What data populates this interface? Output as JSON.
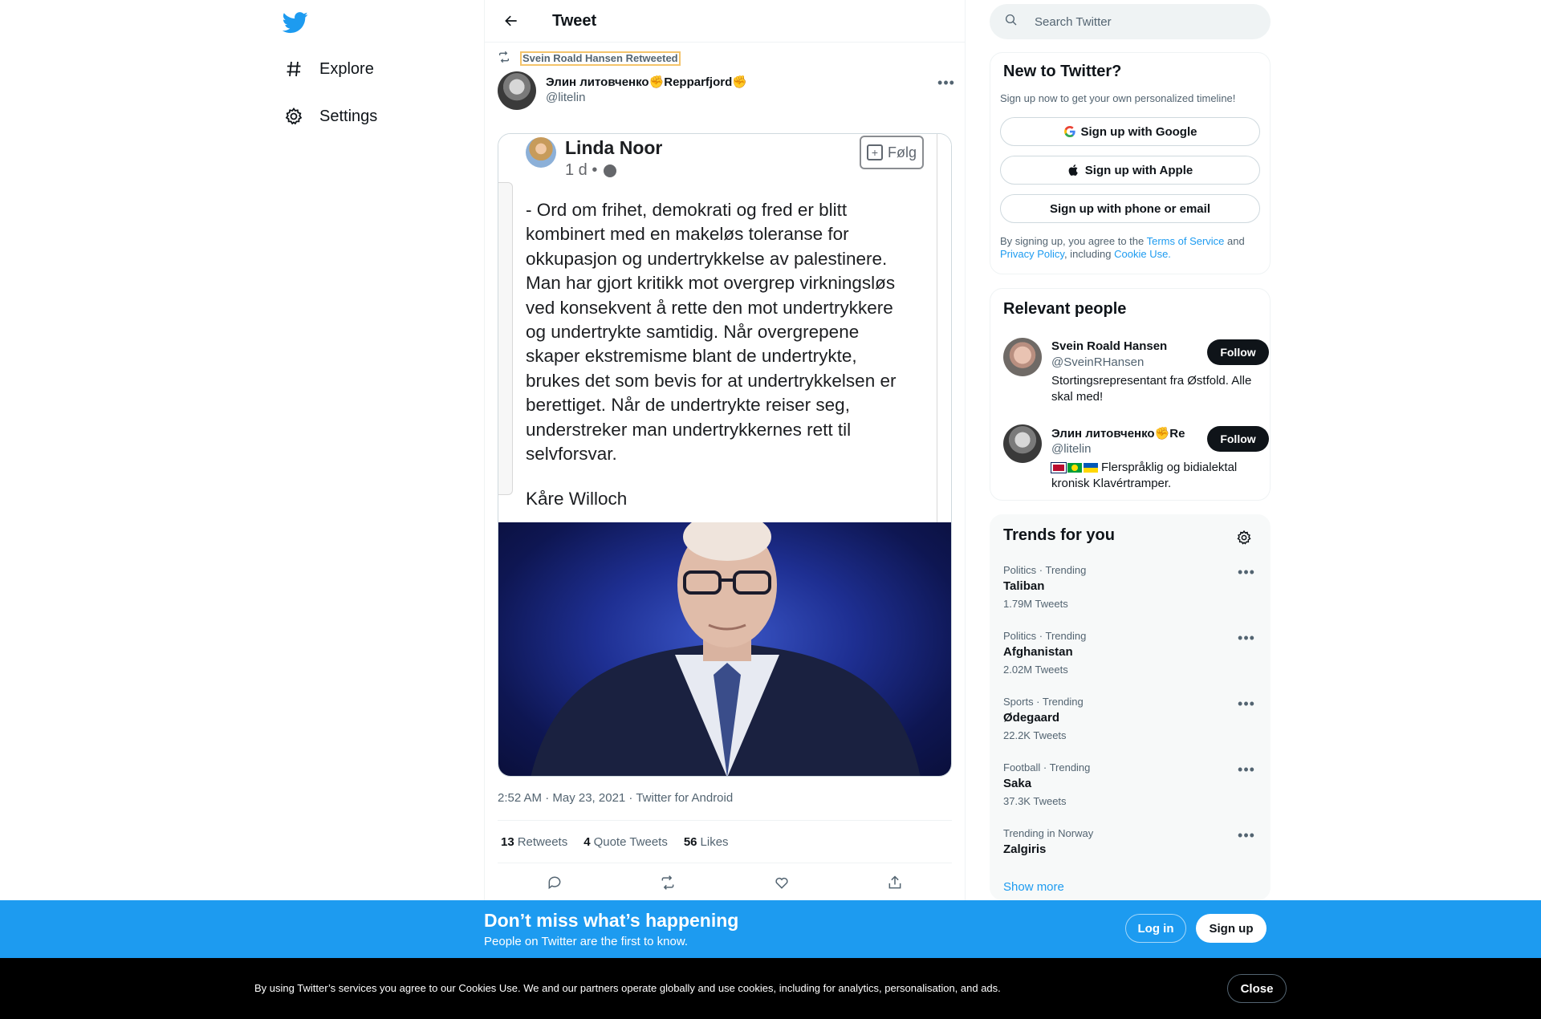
{
  "nav": {
    "explore_label": "Explore",
    "settings_label": "Settings"
  },
  "header": {
    "title": "Tweet"
  },
  "tweet": {
    "retweeted_by": "Svein Roald Hansen Retweeted",
    "author_name": "Элин литовченко✊Repparfjord✊",
    "author_handle": "@litelin",
    "timestamp": "2:52 AM · May 23, 2021 · Twitter for Android",
    "stats": {
      "retweets_count": "13",
      "retweets_label": "Retweets",
      "quotes_count": "4",
      "quotes_label": "Quote Tweets",
      "likes_count": "56",
      "likes_label": "Likes"
    },
    "media": {
      "fb_name": "Linda Noor",
      "fb_meta": "1 d •",
      "fb_follow": "Følg",
      "fb_text": "- Ord om frihet, demokrati og fred er blitt\nkombinert med en makeløs toleranse for\nokkupasjon og undertrykkelse av palestinere.\nMan har gjort kritikk mot overgrep virkningsløs\nved konsekvent å rette den mot undertrykkere\nog undertrykte samtidig. Når overgrepene\nskaper ekstremisme blant de undertrykte,\nbrukes det som bevis for at undertrykkelsen er\nberettiget. Når de undertrykte reiser seg,\nunderstreker man undertrykkernes rett til\nselvforsvar.",
      "fb_signature": "Kåre Willoch"
    }
  },
  "search": {
    "placeholder": "Search Twitter"
  },
  "new_to_twitter": {
    "title": "New to Twitter?",
    "subtitle": "Sign up now to get your own personalized timeline!",
    "google_label": "Sign up with Google",
    "apple_label": "Sign up with Apple",
    "phone_label": "Sign up with phone or email",
    "legal_prefix": "By signing up, you agree to the ",
    "terms_link": "Terms of Service",
    "legal_and": " and ",
    "privacy_link": "Privacy Policy",
    "legal_including": ", including ",
    "cookie_link": "Cookie Use."
  },
  "relevant_people": {
    "title": "Relevant people",
    "people": [
      {
        "name": "Svein Roald Hansen",
        "handle": "@SveinRHansen",
        "bio": "Stortingsrepresentant fra Østfold. Alle skal med!",
        "follow_label": "Follow"
      },
      {
        "name": "Элин литовченко✊Re",
        "handle": "@litelin",
        "bio": "Flerspråklig og bidialektal kronisk Klavértramper.",
        "follow_label": "Follow"
      }
    ]
  },
  "trends": {
    "title": "Trends for you",
    "items": [
      {
        "meta": "Politics · Trending",
        "name": "Taliban",
        "count": "1.79M Tweets"
      },
      {
        "meta": "Politics · Trending",
        "name": "Afghanistan",
        "count": "2.02M Tweets"
      },
      {
        "meta": "Sports · Trending",
        "name": "Ødegaard",
        "count": "22.2K Tweets"
      },
      {
        "meta": "Football · Trending",
        "name": "Saka",
        "count": "37.3K Tweets"
      },
      {
        "meta": "Trending in Norway",
        "name": "Zalgiris",
        "count": ""
      }
    ],
    "show_more": "Show more"
  },
  "banner": {
    "heading": "Don’t miss what’s happening",
    "subheading": "People on Twitter are the first to know.",
    "login_label": "Log in",
    "signup_label": "Sign up"
  },
  "cookie_bar": {
    "text": "By using Twitter’s services you agree to our Cookies Use. We and our partners operate globally and use cookies, including for analytics, personalisation, and ads.",
    "close_label": "Close"
  },
  "colors": {
    "brand_blue": "#1d9bf0",
    "text_primary": "#0f1419",
    "text_secondary": "#536471"
  },
  "icons": [
    "twitter-logo-icon",
    "hashtag-icon",
    "gear-icon",
    "back-arrow-icon",
    "retweet-icon",
    "more-icon",
    "search-icon",
    "google-icon",
    "apple-icon",
    "reply-icon",
    "like-icon",
    "share-icon"
  ]
}
